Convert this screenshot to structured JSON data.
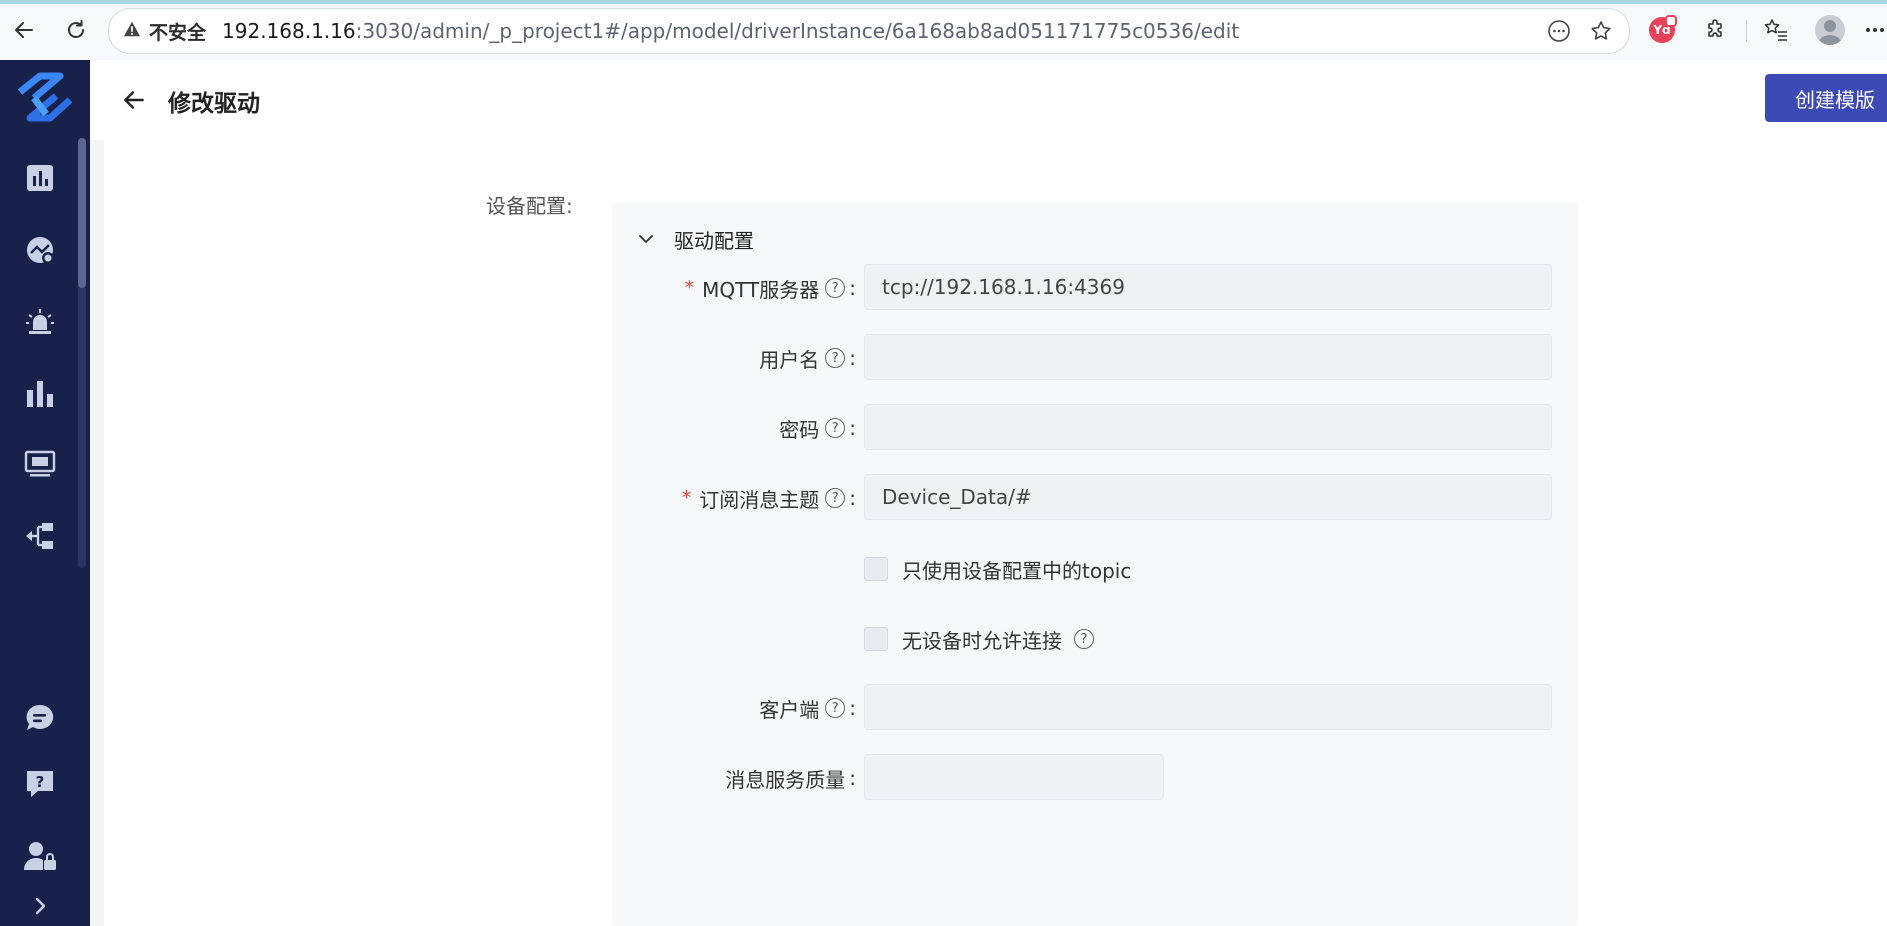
{
  "browser": {
    "security_label": "不安全",
    "url_host": "192.168.1.16",
    "url_path": ":3030/admin/_p_project1#/app/model/driverInstance/6a168ab8ad051171775c0536/edit",
    "extension_badge": "Yd"
  },
  "header": {
    "title": "修改驱动",
    "create_template_label": "创建模版"
  },
  "sidebar": {
    "items": [
      "dashboard-icon",
      "monitor-chart-icon",
      "alarm-icon",
      "bar-chart-icon",
      "screen-icon",
      "flow-icon",
      "chat-icon",
      "help-icon",
      "user-lock-icon",
      "expand-icon"
    ]
  },
  "form": {
    "device_config_label": "设备配置:",
    "section_title": "驱动配置",
    "mqtt_server_label": "MQTT服务器",
    "mqtt_server_value": "tcp://192.168.1.16:4369",
    "username_label": "用户名",
    "username_value": "",
    "password_label": "密码",
    "password_value": "",
    "topic_label": "订阅消息主题",
    "topic_value": "Device_Data/#",
    "only_device_topic_label": "只使用设备配置中的topic",
    "allow_no_device_label": "无设备时允许连接",
    "client_label": "客户端",
    "client_value": "",
    "qos_label": "消息服务质量",
    "qos_value": ""
  }
}
